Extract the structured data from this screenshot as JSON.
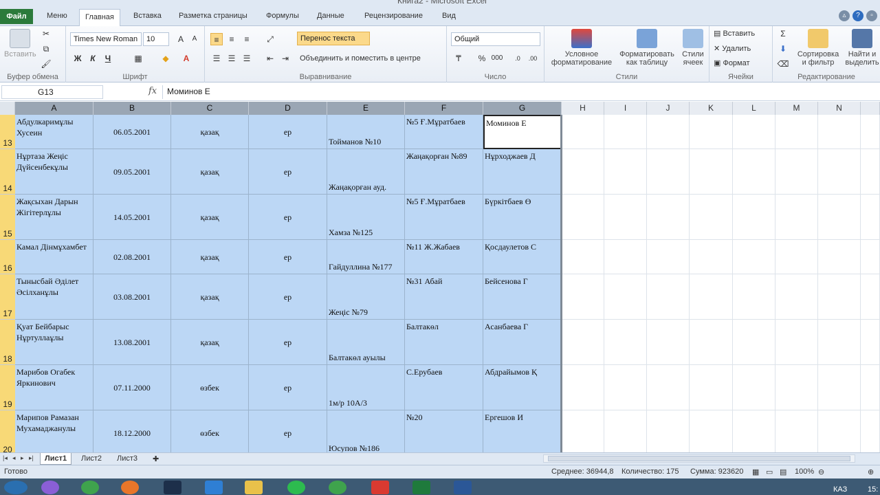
{
  "window": {
    "title": "Книга2 - Microsoft Excel"
  },
  "ribbon_tabs": [
    "Файл",
    "Меню",
    "Главная",
    "Вставка",
    "Разметка страницы",
    "Формулы",
    "Данные",
    "Рецензирование",
    "Вид"
  ],
  "ribbon": {
    "clipboard": {
      "paste": "Вставить",
      "label": "Буфер обмена"
    },
    "font": {
      "name": "Times New Roman",
      "size": "10",
      "bold": "Ж",
      "italic": "К",
      "underline": "Ч",
      "label": "Шрифт"
    },
    "alignment": {
      "wrap": "Перенос текста",
      "merge": "Объединить и поместить в центре",
      "label": "Выравнивание"
    },
    "number": {
      "format": "Общий",
      "label": "Число"
    },
    "styles": {
      "conditional": "Условное форматирование",
      "as_table": "Форматировать как таблицу",
      "cell_styles": "Стили ячеек",
      "label": "Стили"
    },
    "cells": {
      "insert": "Вставить",
      "delete": "Удалить",
      "format": "Формат",
      "label": "Ячейки"
    },
    "editing": {
      "sort": "Сортировка и фильтр",
      "find": "Найти и выделить",
      "label": "Редактирование"
    }
  },
  "formula_bar": {
    "name_box": "G13",
    "fx": "fx",
    "value": "Моминов Е"
  },
  "columns": [
    "A",
    "B",
    "C",
    "D",
    "E",
    "F",
    "G",
    "H",
    "I",
    "J",
    "K",
    "L",
    "M",
    "N"
  ],
  "rows": [
    {
      "num": "13",
      "a": "Абдулкаримұлы Хусеин",
      "b": "06.05.2001",
      "c": "қазақ",
      "d": "ер",
      "e": "Тойманов №10",
      "f": "№5 Ғ.Мұратбаев",
      "g": "Моминов Е"
    },
    {
      "num": "14",
      "a": "Нұртаза Жеңіс Дүйсенбекұлы",
      "b": "09.05.2001",
      "c": "қазақ",
      "d": "ер",
      "e": "Жаңақорған ауд.",
      "f": "Жаңақорған №89",
      "g": "Нұрходжаев Д"
    },
    {
      "num": "15",
      "a": "Жақсыхан Дарын Жігітерлұлы",
      "b": "14.05.2001",
      "c": "қазақ",
      "d": "ер",
      "e": "Хамза №125",
      "f": "№5 Ғ.Мұратбаев",
      "g": "Бүркітбаев Ө"
    },
    {
      "num": "16",
      "a": "Камал Дінмұхамбет",
      "b": "02.08.2001",
      "c": "қазақ",
      "d": "ер",
      "e": "Гайдуллина №177",
      "f": "№11 Ж.Жабаев",
      "g": "Қосдаулетов С"
    },
    {
      "num": "17",
      "a": "Тынысбай Әділет Әсілханұлы",
      "b": "03.08.2001",
      "c": "қазақ",
      "d": "ер",
      "e": "Жеңіс №79",
      "f": "№31 Абай",
      "g": "Бейсенова Г"
    },
    {
      "num": "18",
      "a": "Қуат Бейбарыс Нұртуллаұлы",
      "b": "13.08.2001",
      "c": "қазақ",
      "d": "ер",
      "e": "Балтакөл ауылы",
      "f": "Балтакөл",
      "g": "Асанбаева Г"
    },
    {
      "num": "19",
      "a": "Марибов Огабек Яркинович",
      "b": "07.11.2000",
      "c": "өзбек",
      "d": "ер",
      "e": "1м/р 10А/3",
      "f": "С.Ерубаев",
      "g": "Абдрайымов Қ"
    },
    {
      "num": "20",
      "a": "Марипов Рамазан Мухамаджанулы",
      "b": "18.12.2000",
      "c": "өзбек",
      "d": "ер",
      "e": "Юсупов №186",
      "f": "№20",
      "g": "Ергешов И"
    }
  ],
  "sheets": [
    "Лист1",
    "Лист2",
    "Лист3"
  ],
  "status": {
    "ready": "Готово",
    "average": "Среднее: 36944,8",
    "count": "Количество: 175",
    "sum": "Сумма: 923620",
    "zoom": "100%"
  },
  "taskbar": {
    "lang": "КАЗ",
    "clock": "15:"
  }
}
